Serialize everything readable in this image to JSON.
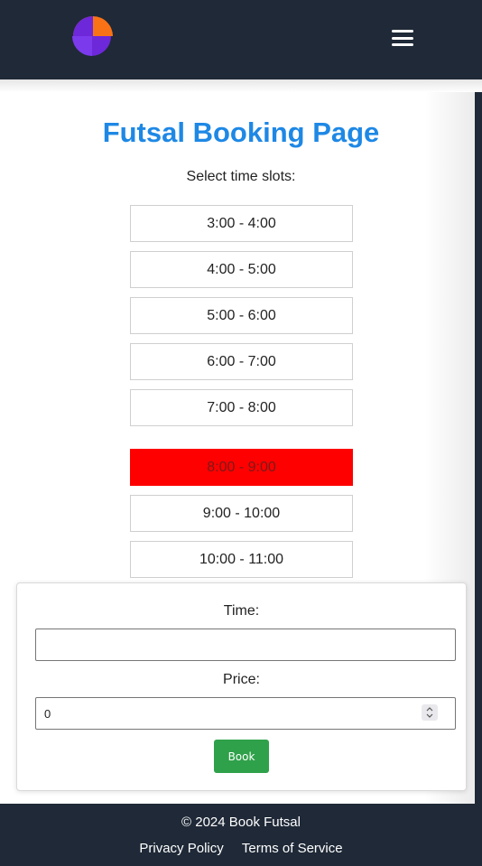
{
  "header": {
    "logo_icon": "app-logo-icon",
    "menu_icon": "hamburger-menu-icon"
  },
  "main": {
    "title": "Futsal Booking Page",
    "select_label": "Select time slots:",
    "time_slots": [
      {
        "label": "3:00 - 4:00",
        "booked": false
      },
      {
        "label": "4:00 - 5:00",
        "booked": false
      },
      {
        "label": "5:00 - 6:00",
        "booked": false
      },
      {
        "label": "6:00 - 7:00",
        "booked": false
      },
      {
        "label": "7:00 - 8:00",
        "booked": false
      },
      {
        "label": "8:00 - 9:00",
        "booked": true
      },
      {
        "label": "9:00 - 10:00",
        "booked": false
      },
      {
        "label": "10:00 - 11:00",
        "booked": false
      }
    ]
  },
  "form": {
    "time_label": "Time:",
    "time_value": "",
    "price_label": "Price:",
    "price_value": "0",
    "book_label": "Book"
  },
  "footer": {
    "copyright": "© 2024 Book Futsal",
    "privacy_label": "Privacy Policy",
    "terms_label": "Terms of Service"
  },
  "colors": {
    "navbar": "#1f2937",
    "title": "#1e88e5",
    "booked_slot": "#ff0000",
    "book_button": "#2fa14a"
  }
}
